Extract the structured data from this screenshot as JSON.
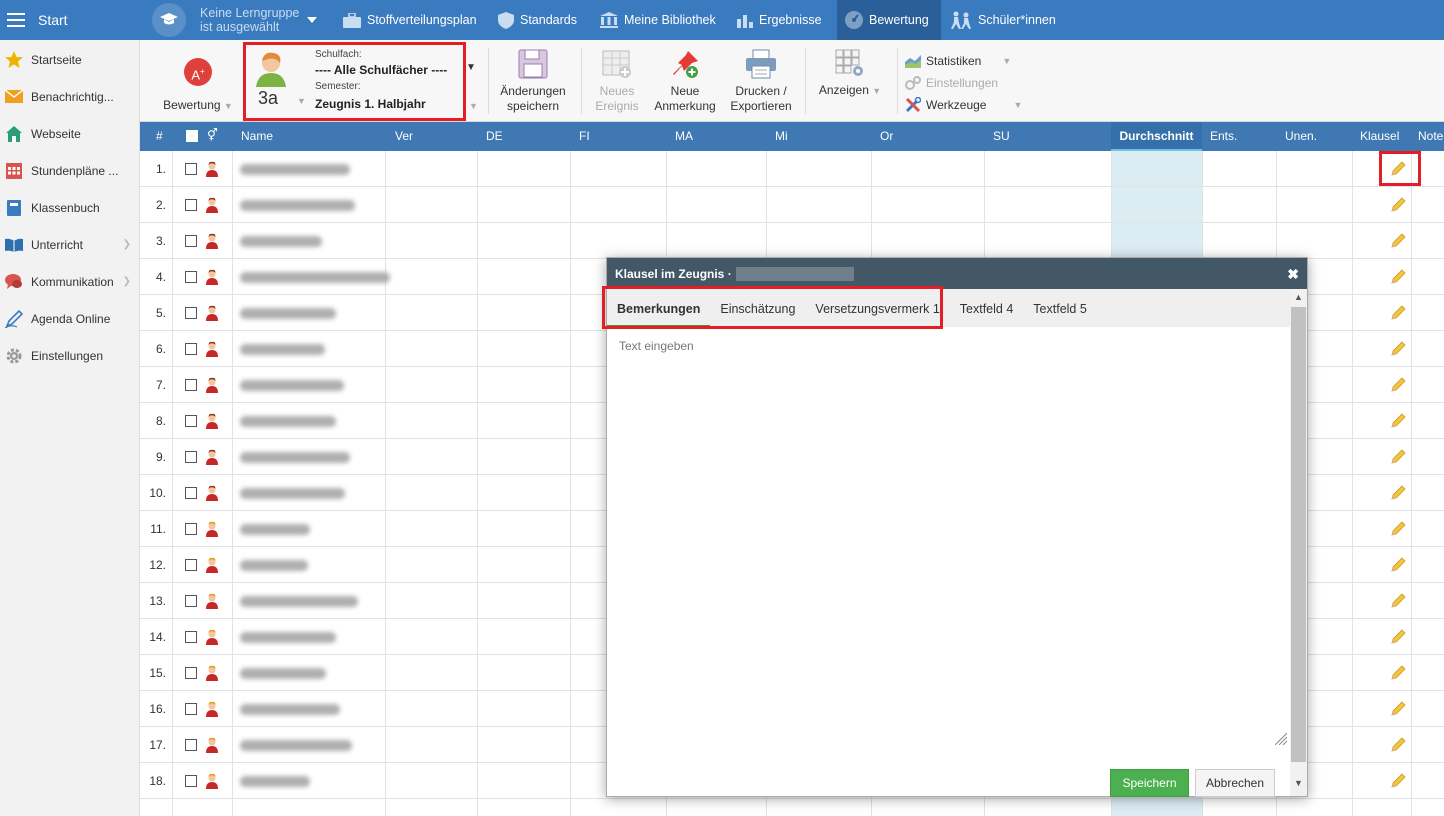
{
  "topbar": {
    "start": "Start",
    "group_line1": "Keine Lerngruppe",
    "group_line2": "ist ausgewählt",
    "nav": [
      {
        "label": "Stoffverteilungsplan",
        "icon": "briefcase-icon"
      },
      {
        "label": "Standards",
        "icon": "shield-icon"
      },
      {
        "label": "Meine Bibliothek",
        "icon": "library-icon"
      },
      {
        "label": "Ergebnisse",
        "icon": "bar-chart-icon"
      },
      {
        "label": "Bewertung",
        "icon": "gauge-icon"
      },
      {
        "label": "Schüler*innen",
        "icon": "students-icon"
      }
    ]
  },
  "sidebar": {
    "items": [
      {
        "label": "Startseite",
        "icon": "star-icon"
      },
      {
        "label": "Benachrichtig...",
        "icon": "envelope-icon"
      },
      {
        "label": "Webseite",
        "icon": "home-icon"
      },
      {
        "label": "Stundenpläne ...",
        "icon": "calendar-icon"
      },
      {
        "label": "Klassenbuch",
        "icon": "book-icon"
      },
      {
        "label": "Unterricht",
        "icon": "open-book-icon"
      },
      {
        "label": "Kommunikation",
        "icon": "chat-icon"
      },
      {
        "label": "Agenda Online",
        "icon": "pen-icon"
      },
      {
        "label": "Einstellungen",
        "icon": "gear-icon"
      }
    ]
  },
  "toolbar": {
    "bewertung": "Bewertung",
    "class_name": "3a",
    "schulfach_label": "Schulfach:",
    "schulfach_value": "---- Alle Schulfächer ----",
    "semester_label": "Semester:",
    "semester_value": "Zeugnis 1. Halbjahr",
    "save_line1": "Änderungen",
    "save_line2": "speichern",
    "event_line1": "Neues",
    "event_line2": "Ereignis",
    "note_line1": "Neue",
    "note_line2": "Anmerkung",
    "print_line1": "Drucken /",
    "print_line2": "Exportieren",
    "anzeigen": "Anzeigen",
    "statistiken": "Statistiken",
    "einstellungen": "Einstellungen",
    "werkzeuge": "Werkzeuge"
  },
  "grid": {
    "headers": {
      "num": "#",
      "name": "Name",
      "ver": "Ver",
      "de": "DE",
      "fi": "FI",
      "ma": "MA",
      "mi": "Mi",
      "or": "Or",
      "su": "SU",
      "avg": "Durchschnitt",
      "ents": "Ents.",
      "unen": "Unen.",
      "klausel": "Klausel",
      "note": "Note"
    },
    "rows": [
      {
        "num": "1.",
        "gender": "m"
      },
      {
        "num": "2.",
        "gender": "m"
      },
      {
        "num": "3.",
        "gender": "m"
      },
      {
        "num": "4.",
        "gender": "m"
      },
      {
        "num": "5.",
        "gender": "m"
      },
      {
        "num": "6.",
        "gender": "m"
      },
      {
        "num": "7.",
        "gender": "m"
      },
      {
        "num": "8.",
        "gender": "m"
      },
      {
        "num": "9.",
        "gender": "m"
      },
      {
        "num": "10.",
        "gender": "m"
      },
      {
        "num": "11.",
        "gender": "f"
      },
      {
        "num": "12.",
        "gender": "f"
      },
      {
        "num": "13.",
        "gender": "f"
      },
      {
        "num": "14.",
        "gender": "f"
      },
      {
        "num": "15.",
        "gender": "f"
      },
      {
        "num": "16.",
        "gender": "f"
      },
      {
        "num": "17.",
        "gender": "f"
      },
      {
        "num": "18.",
        "gender": "f"
      }
    ]
  },
  "modal": {
    "title": "Klausel im Zeugnis ·",
    "tabs": [
      "Bemerkungen",
      "Einschätzung",
      "Versetzungsvermerk 1",
      "Textfeld 4",
      "Textfeld 5"
    ],
    "placeholder": "Text eingeben",
    "save": "Speichern",
    "cancel": "Abbrechen",
    "close": "✖"
  },
  "colors": {
    "topbar": "#3a7bbf",
    "grid_header": "#3f78b3",
    "highlight_red": "#e31e24",
    "save_green": "#4caf50"
  }
}
